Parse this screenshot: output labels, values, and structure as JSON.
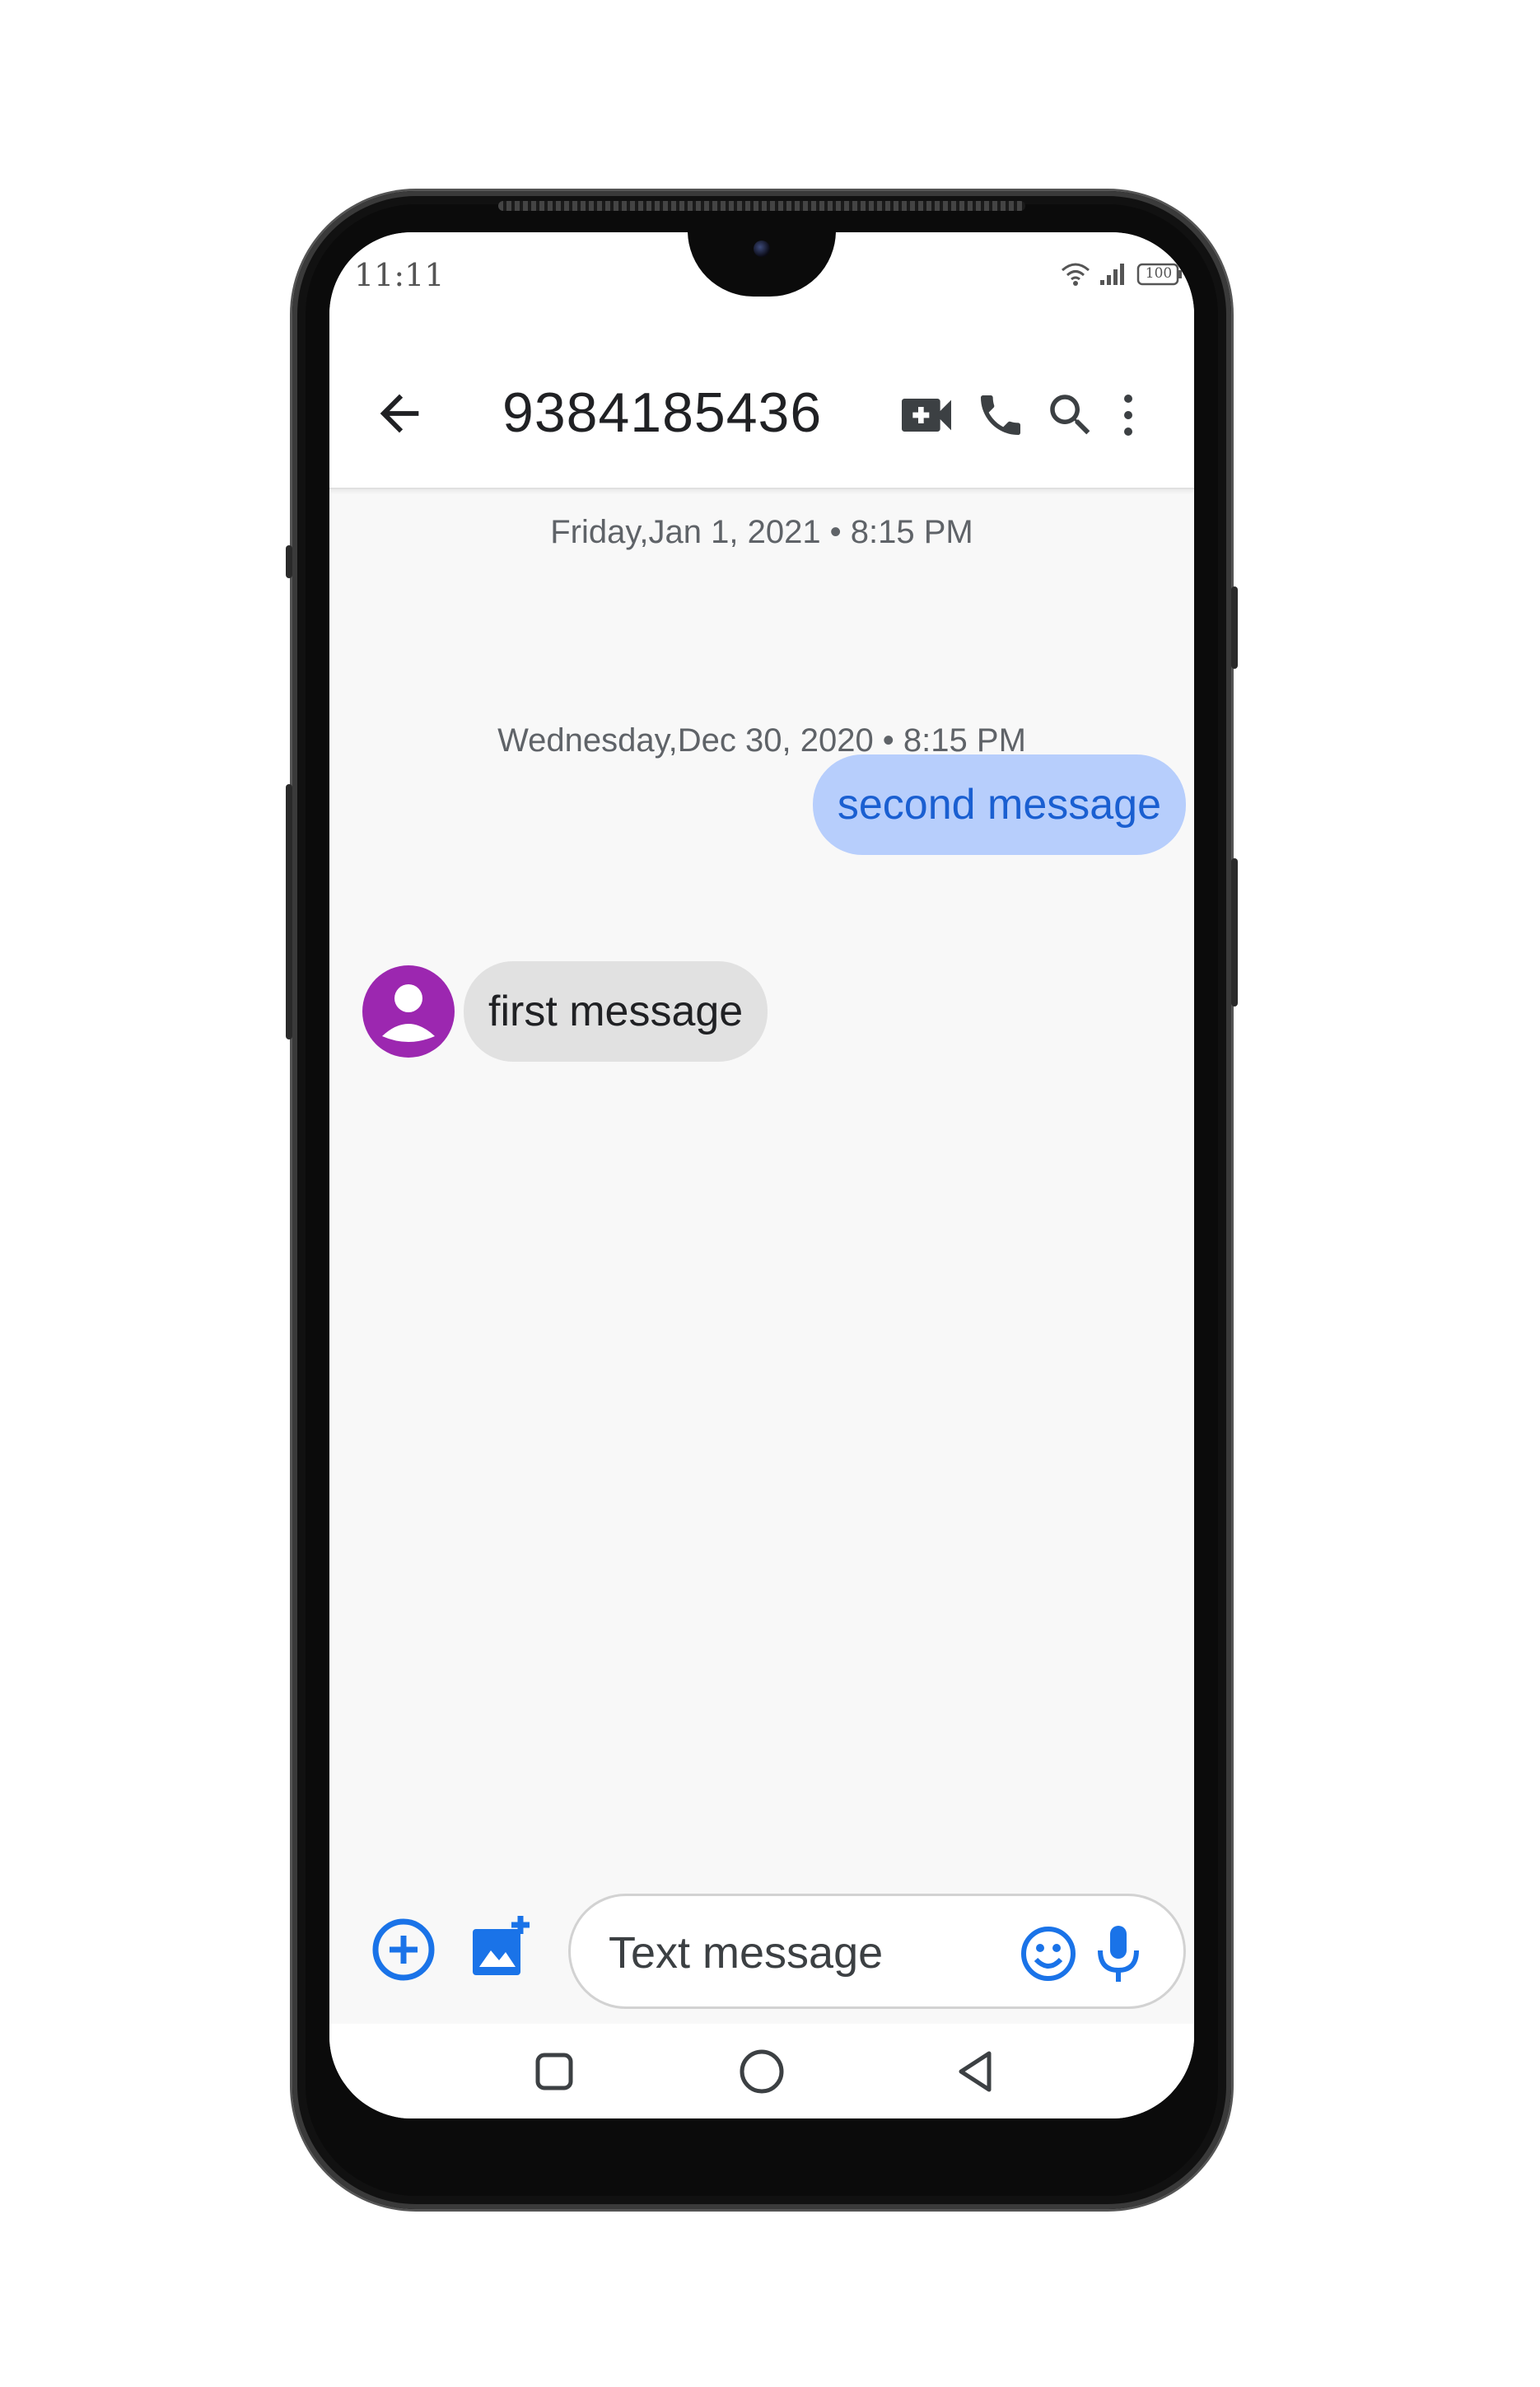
{
  "status_bar": {
    "time": "11:11",
    "battery": "100",
    "icons": [
      "wifi-icon",
      "signal-icon",
      "battery-icon"
    ]
  },
  "app_bar": {
    "back_icon": "arrow-back-icon",
    "title": "9384185436",
    "actions": [
      "video-call-icon",
      "phone-call-icon",
      "search-icon",
      "more-vert-icon"
    ]
  },
  "conversation": {
    "messages": [
      {
        "timestamp": "Friday,Jan 1, 2021 • 8:15 PM",
        "direction": "outgoing",
        "text": "second message"
      },
      {
        "timestamp": "Wednesday,Dec 30, 2020 • 8:15 PM",
        "direction": "incoming",
        "text": "first message",
        "avatar_icon": "person-icon"
      }
    ]
  },
  "composer": {
    "add_icon": "add-circle-icon",
    "gallery_icon": "add-photo-icon",
    "placeholder": "Text message",
    "emoji_icon": "emoji-icon",
    "mic_icon": "mic-icon"
  },
  "nav_bar": {
    "items": [
      "recents-square-icon",
      "home-circle-icon",
      "back-triangle-icon"
    ]
  },
  "colors": {
    "accent": "#1a73e8",
    "outgoing_bubble": "#b7cefc",
    "outgoing_text": "#1a5fd1",
    "incoming_bubble": "#e1e1e1",
    "avatar": "#9c27b0"
  }
}
